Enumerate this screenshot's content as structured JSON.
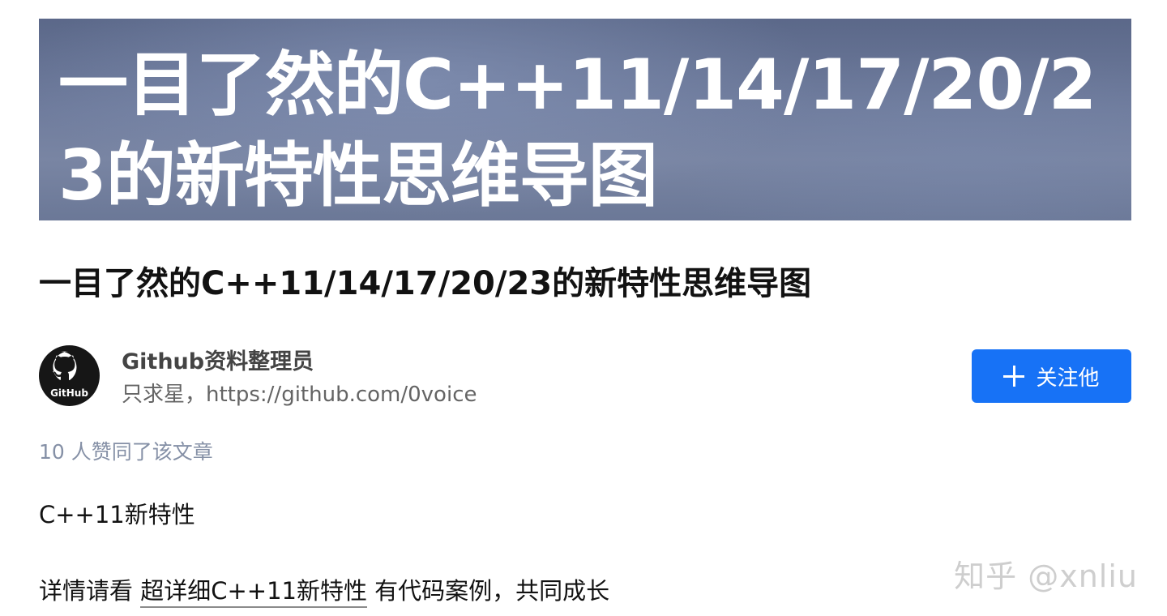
{
  "banner": {
    "title": "一目了然的C++11/14/17/20/23的新特性思维导图"
  },
  "article": {
    "title": "一目了然的C++11/14/17/20/23的新特性思维导图"
  },
  "author": {
    "avatar_label": "GitHub",
    "name": "Github资料整理员",
    "bio": "只求星，https://github.com/0voice"
  },
  "follow_button": {
    "label": "关注他",
    "icon": "plus-icon",
    "color": "#1772f6"
  },
  "likes": {
    "text": "10 人赞同了该文章"
  },
  "content": {
    "section_heading": "C++11新特性",
    "detail_prefix": "详情请看 ",
    "detail_link": "超详细C++11新特性",
    "detail_suffix": " 有代码案例，共同成长"
  },
  "watermark": "知乎 @xnliu"
}
